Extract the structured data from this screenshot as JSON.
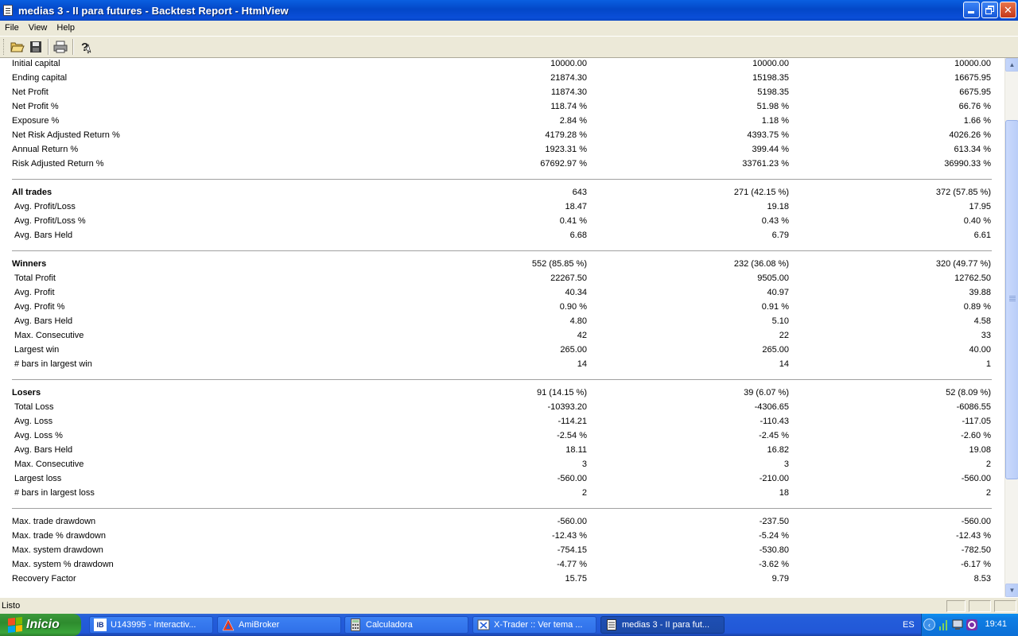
{
  "window": {
    "title": "medias 3 - II para futures - Backtest Report - HtmlView"
  },
  "menu": [
    "File",
    "View",
    "Help"
  ],
  "toolbar": {
    "buttons": [
      "open-icon",
      "save-icon",
      "print-icon",
      "help-icon"
    ]
  },
  "report": {
    "rows": [
      {
        "label": "Initial capital",
        "values": [
          "10000.00",
          "10000.00",
          "10000.00"
        ],
        "bold": false,
        "indent": false
      },
      {
        "label": "Ending capital",
        "values": [
          "21874.30",
          "15198.35",
          "16675.95"
        ],
        "bold": false,
        "indent": false
      },
      {
        "label": "Net Profit",
        "values": [
          "11874.30",
          "5198.35",
          "6675.95"
        ],
        "bold": false,
        "indent": false
      },
      {
        "label": "Net Profit %",
        "values": [
          "118.74 %",
          "51.98 %",
          "66.76 %"
        ],
        "bold": false,
        "indent": false
      },
      {
        "label": "Exposure %",
        "values": [
          "2.84 %",
          "1.18 %",
          "1.66 %"
        ],
        "bold": false,
        "indent": false
      },
      {
        "label": "Net Risk Adjusted Return %",
        "values": [
          "4179.28 %",
          "4393.75 %",
          "4026.26 %"
        ],
        "bold": false,
        "indent": false
      },
      {
        "label": "Annual Return %",
        "values": [
          "1923.31 %",
          "399.44 %",
          "613.34 %"
        ],
        "bold": false,
        "indent": false
      },
      {
        "label": "Risk Adjusted Return %",
        "values": [
          "67692.97 %",
          "33761.23 %",
          "36990.33 %"
        ],
        "bold": false,
        "indent": false
      },
      {
        "separator": true
      },
      {
        "label": "All trades",
        "values": [
          "643",
          "271 (42.15 %)",
          "372 (57.85 %)"
        ],
        "bold": true,
        "indent": false
      },
      {
        "label": "Avg. Profit/Loss",
        "values": [
          "18.47",
          "19.18",
          "17.95"
        ],
        "bold": false,
        "indent": true
      },
      {
        "label": "Avg. Profit/Loss %",
        "values": [
          "0.41 %",
          "0.43 %",
          "0.40 %"
        ],
        "bold": false,
        "indent": true
      },
      {
        "label": "Avg. Bars Held",
        "values": [
          "6.68",
          "6.79",
          "6.61"
        ],
        "bold": false,
        "indent": true
      },
      {
        "separator": true
      },
      {
        "label": "Winners",
        "values": [
          "552 (85.85 %)",
          "232 (36.08 %)",
          "320 (49.77 %)"
        ],
        "bold": true,
        "indent": false
      },
      {
        "label": "Total Profit",
        "values": [
          "22267.50",
          "9505.00",
          "12762.50"
        ],
        "bold": false,
        "indent": true
      },
      {
        "label": "Avg. Profit",
        "values": [
          "40.34",
          "40.97",
          "39.88"
        ],
        "bold": false,
        "indent": true
      },
      {
        "label": "Avg. Profit %",
        "values": [
          "0.90 %",
          "0.91 %",
          "0.89 %"
        ],
        "bold": false,
        "indent": true
      },
      {
        "label": "Avg. Bars Held",
        "values": [
          "4.80",
          "5.10",
          "4.58"
        ],
        "bold": false,
        "indent": true
      },
      {
        "label": "Max. Consecutive",
        "values": [
          "42",
          "22",
          "33"
        ],
        "bold": false,
        "indent": true
      },
      {
        "label": "Largest win",
        "values": [
          "265.00",
          "265.00",
          "40.00"
        ],
        "bold": false,
        "indent": true
      },
      {
        "label": "# bars in largest win",
        "values": [
          "14",
          "14",
          "1"
        ],
        "bold": false,
        "indent": true
      },
      {
        "separator": true
      },
      {
        "label": "Losers",
        "values": [
          "91 (14.15 %)",
          "39 (6.07 %)",
          "52 (8.09 %)"
        ],
        "bold": true,
        "indent": false
      },
      {
        "label": "Total Loss",
        "values": [
          "-10393.20",
          "-4306.65",
          "-6086.55"
        ],
        "bold": false,
        "indent": true
      },
      {
        "label": "Avg. Loss",
        "values": [
          "-114.21",
          "-110.43",
          "-117.05"
        ],
        "bold": false,
        "indent": true
      },
      {
        "label": "Avg. Loss %",
        "values": [
          "-2.54 %",
          "-2.45 %",
          "-2.60 %"
        ],
        "bold": false,
        "indent": true
      },
      {
        "label": "Avg. Bars Held",
        "values": [
          "18.11",
          "16.82",
          "19.08"
        ],
        "bold": false,
        "indent": true
      },
      {
        "label": "Max. Consecutive",
        "values": [
          "3",
          "3",
          "2"
        ],
        "bold": false,
        "indent": true
      },
      {
        "label": "Largest loss",
        "values": [
          "-560.00",
          "-210.00",
          "-560.00"
        ],
        "bold": false,
        "indent": true
      },
      {
        "label": "# bars in largest loss",
        "values": [
          "2",
          "18",
          "2"
        ],
        "bold": false,
        "indent": true
      },
      {
        "separator": true
      },
      {
        "label": "Max. trade drawdown",
        "values": [
          "-560.00",
          "-237.50",
          "-560.00"
        ],
        "bold": false,
        "indent": false
      },
      {
        "label": "Max. trade % drawdown",
        "values": [
          "-12.43 %",
          "-5.24 %",
          "-12.43 %"
        ],
        "bold": false,
        "indent": false
      },
      {
        "label": "Max. system drawdown",
        "values": [
          "-754.15",
          "-530.80",
          "-782.50"
        ],
        "bold": false,
        "indent": false
      },
      {
        "label": "Max. system % drawdown",
        "values": [
          "-4.77 %",
          "-3.62 %",
          "-6.17 %"
        ],
        "bold": false,
        "indent": false
      },
      {
        "label": "Recovery Factor",
        "values": [
          "15.75",
          "9.79",
          "8.53"
        ],
        "bold": false,
        "indent": false
      }
    ]
  },
  "status": {
    "text": "Listo"
  },
  "taskbar": {
    "start_label": "Inicio",
    "tasks": [
      {
        "label": "U143995 - Interactiv...",
        "icon": "ib-icon",
        "active": false
      },
      {
        "label": "AmiBroker",
        "icon": "amibroker-icon",
        "active": false
      },
      {
        "label": "Calculadora",
        "icon": "calculator-icon",
        "active": false
      },
      {
        "label": "X-Trader :: Ver tema ...",
        "icon": "browser-icon",
        "active": false
      },
      {
        "label": "medias 3 - II para fut...",
        "icon": "document-icon",
        "active": true
      }
    ],
    "language": "ES",
    "clock": "19:41"
  }
}
